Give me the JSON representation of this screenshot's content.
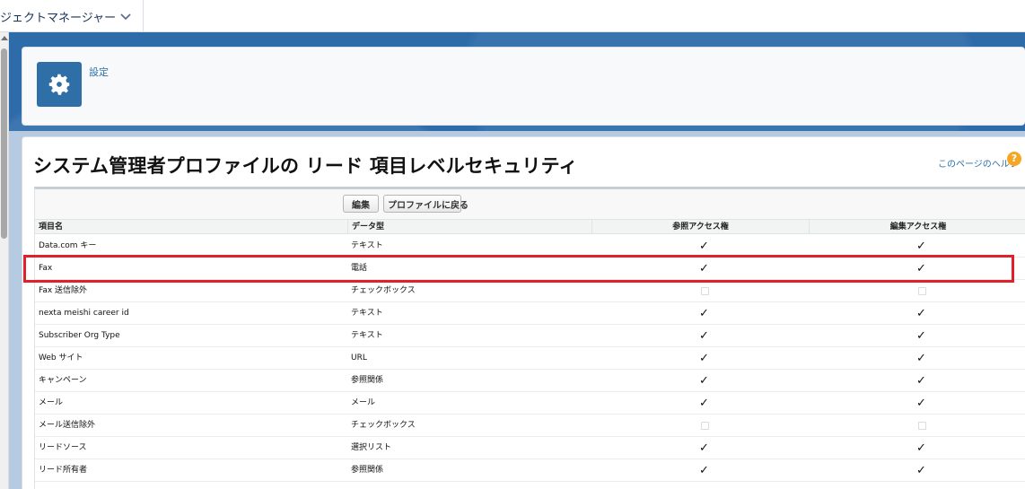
{
  "app": {
    "tab_label": "ジェクトマネージャー"
  },
  "breadcrumb": "設定",
  "page": {
    "title": "システム管理者プロファイルの リード 項目レベルセキュリティ",
    "help_link": "このページのヘルプ",
    "help_symbol": "?"
  },
  "buttons": {
    "edit": "編集",
    "back": "プロファイルに戻る"
  },
  "table": {
    "headers": [
      "項目名",
      "データ型",
      "参照アクセス権",
      "編集アクセス権"
    ],
    "rows": [
      {
        "name": "Data.com キー",
        "type": "テキスト",
        "read": true,
        "edit": true
      },
      {
        "name": "Fax",
        "type": "電話",
        "read": true,
        "edit": true
      },
      {
        "name": "Fax 送信除外",
        "type": "チェックボックス",
        "read": false,
        "edit": false
      },
      {
        "name": "nexta meishi career id",
        "type": "テキスト",
        "read": true,
        "edit": true
      },
      {
        "name": "Subscriber Org Type",
        "type": "テキスト",
        "read": true,
        "edit": true
      },
      {
        "name": "Web サイト",
        "type": "URL",
        "read": true,
        "edit": true
      },
      {
        "name": "キャンペーン",
        "type": "参照関係",
        "read": true,
        "edit": true
      },
      {
        "name": "メール",
        "type": "メール",
        "read": true,
        "edit": true
      },
      {
        "name": "メール送信除外",
        "type": "チェックボックス",
        "read": false,
        "edit": false
      },
      {
        "name": "リードソース",
        "type": "選択リスト",
        "read": true,
        "edit": true
      },
      {
        "name": "リード所有者",
        "type": "参照関係",
        "read": true,
        "edit": true
      }
    ],
    "check_glyph": "✓",
    "highlighted_row": 1
  },
  "colors": {
    "accent": "#2d6fa6",
    "highlight": "#e0202a",
    "help_badge": "#f5a623"
  }
}
